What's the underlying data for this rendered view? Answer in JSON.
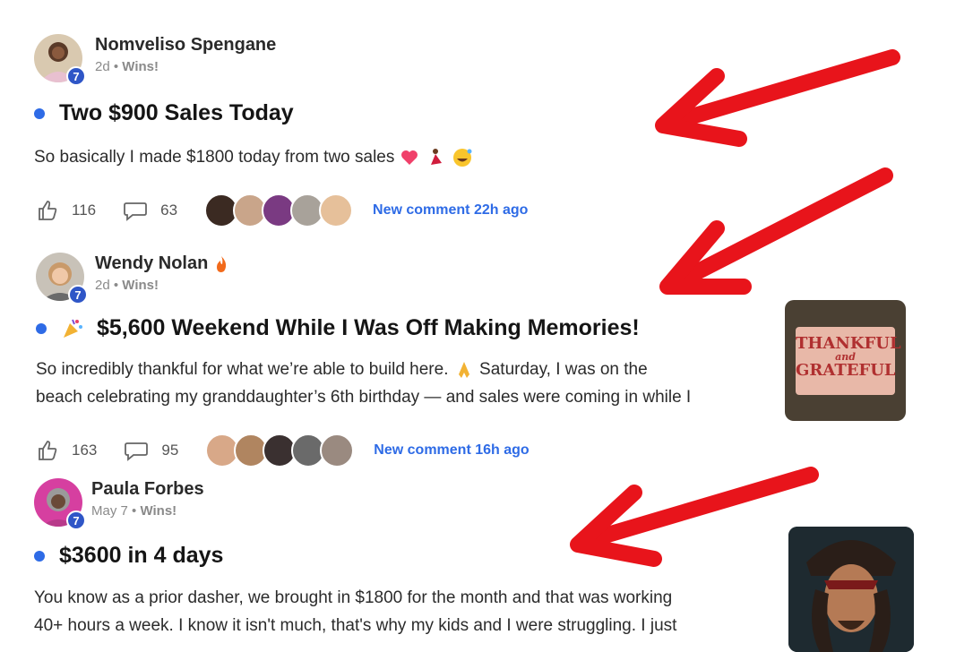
{
  "posts": [
    {
      "author": "Nomveliso Spengane",
      "level": "7",
      "time": "2d",
      "separator": "•",
      "category": "Wins!",
      "title": "Two $900 Sales Today",
      "body": [
        "So basically I made $1800 today from two sales"
      ],
      "likes": "116",
      "comments": "63",
      "new_comment": "New comment 22h ago",
      "icons": [
        "heart-emoji",
        "dancer-emoji",
        "grinning-sweat-emoji"
      ]
    },
    {
      "author": "Wendy Nolan",
      "level": "7",
      "time": "2d",
      "separator": "•",
      "category": "Wins!",
      "title": "$5,600 Weekend While I Was Off Making Memories!",
      "body": [
        "So incredibly thankful for what we’re able to build here.",
        "Saturday, I was on the",
        "beach celebrating my granddaughter’s 6th birthday — and sales were coming in while I"
      ],
      "likes": "163",
      "comments": "95",
      "new_comment": "New comment 16h ago",
      "thumbnail": {
        "line1": "THANKFUL",
        "line2": "and",
        "line3": "GRATEFUL"
      },
      "icons": [
        "fire-emoji",
        "party-popper-emoji",
        "praying-hands-emoji"
      ]
    },
    {
      "author": "Paula Forbes",
      "level": "7",
      "time": "May 7",
      "separator": "•",
      "category": "Wins!",
      "title": "$3600 in 4 days",
      "body": [
        "You know as a prior dasher, we brought in $1800 for the month and that was working",
        "40+ hours a week. I know it isn't much, that's why my kids and I were struggling. I just"
      ],
      "icons": [
        "pirate-photo-thumbnail"
      ]
    }
  ],
  "colors": {
    "accent": "#2e6be6",
    "badge": "#2f56c7",
    "arrow": "#e8141b"
  }
}
